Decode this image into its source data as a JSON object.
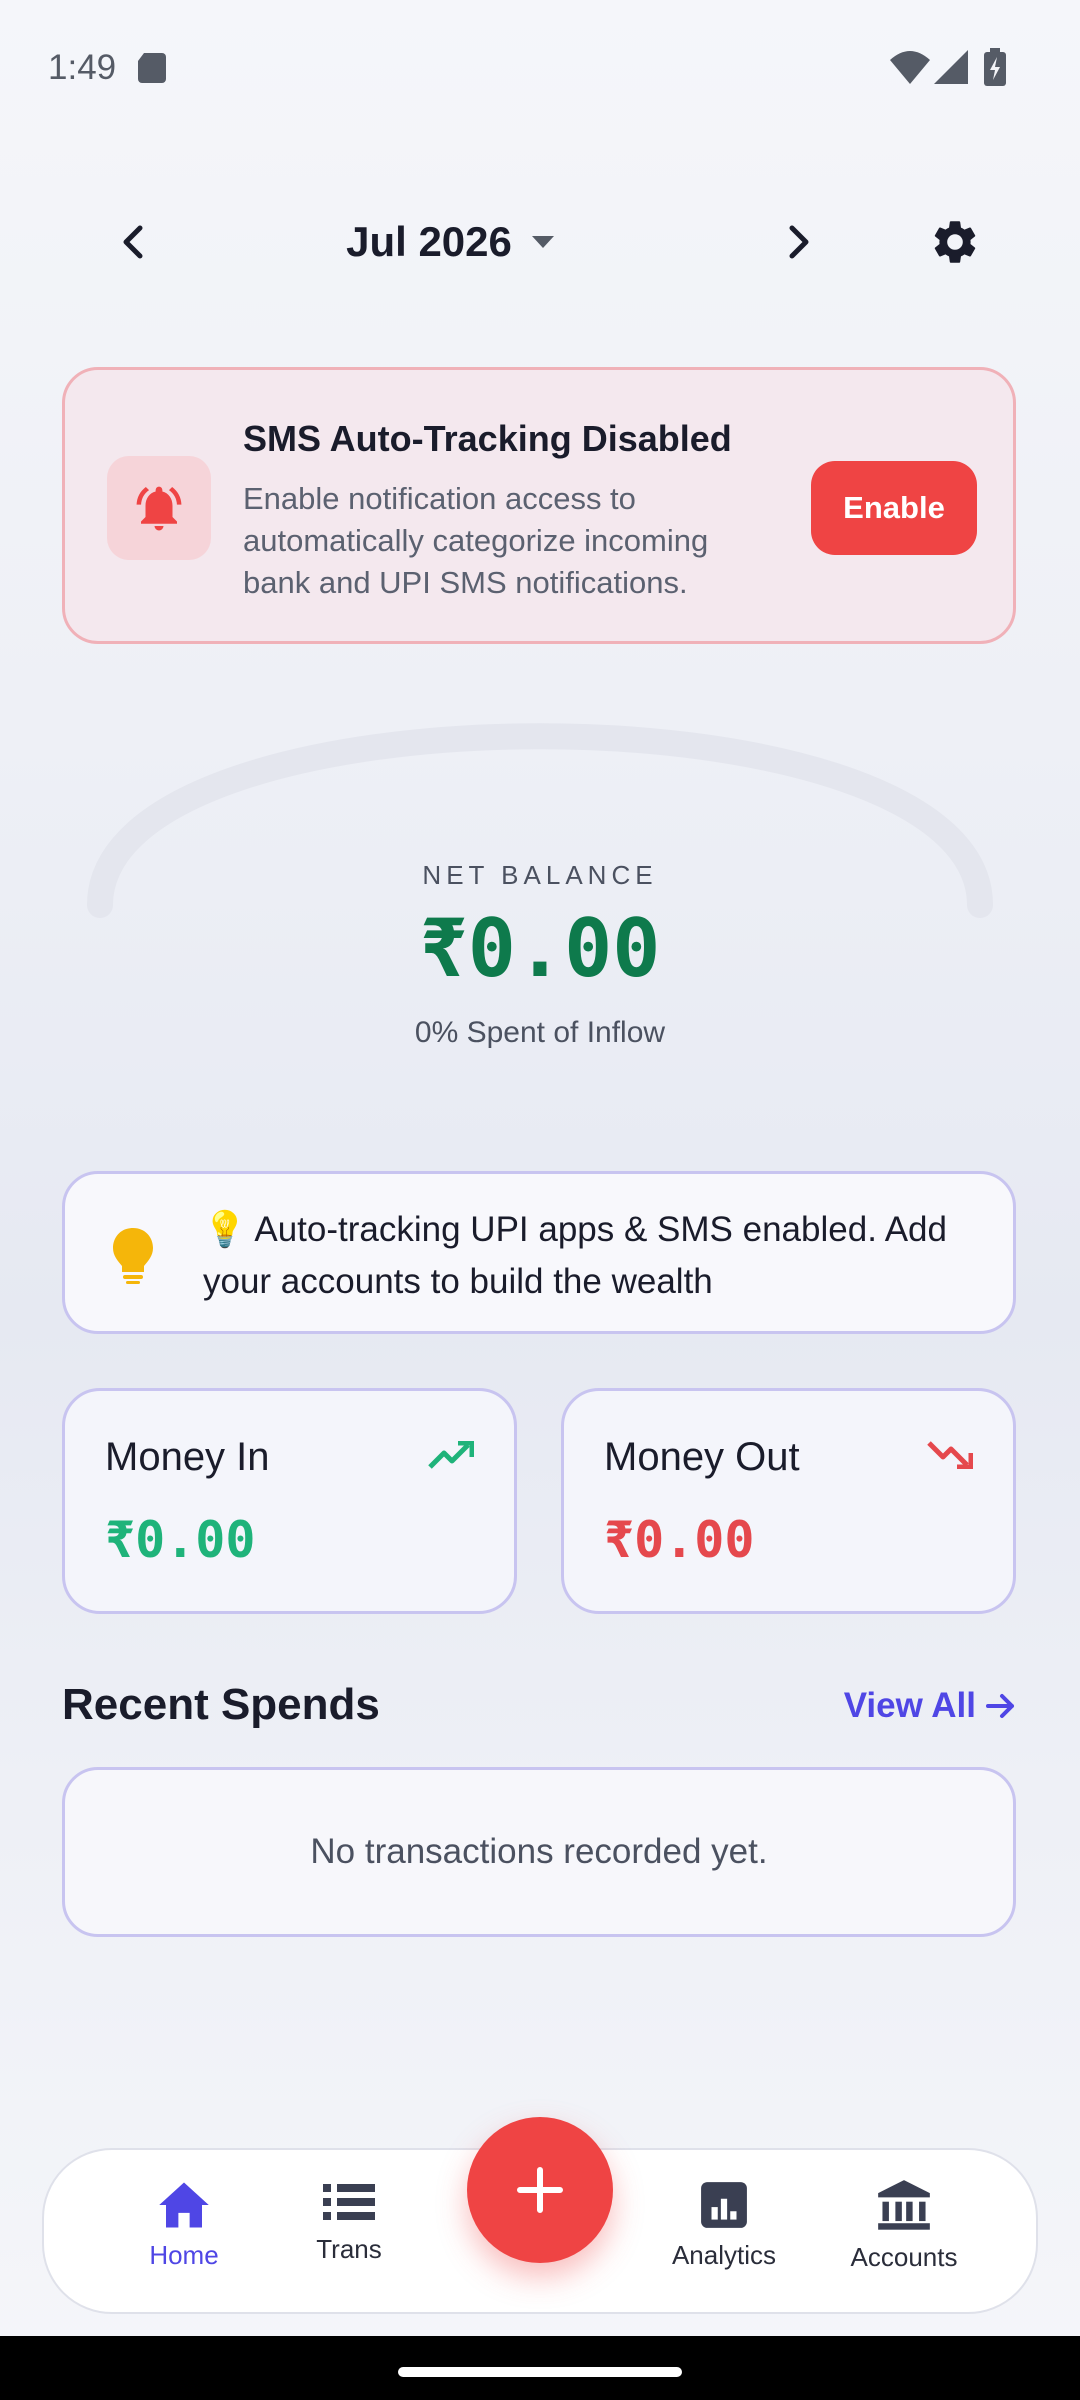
{
  "status_bar": {
    "time": "1:49"
  },
  "header": {
    "month": "Jul 2026"
  },
  "sms_banner": {
    "title": "SMS Auto-Tracking Disabled",
    "description": "Enable notification access to automatically categorize incoming bank and UPI SMS notifications.",
    "button_label": "Enable"
  },
  "balance": {
    "label": "NET BALANCE",
    "value": "₹0.00",
    "subtext": "0% Spent of Inflow",
    "spent_fraction": 0
  },
  "tip": {
    "text": "💡 Auto-tracking UPI apps & SMS enabled. Add your accounts to build the wealth"
  },
  "money_in": {
    "title": "Money In",
    "value": "₹0.00"
  },
  "money_out": {
    "title": "Money Out",
    "value": "₹0.00"
  },
  "recent": {
    "title": "Recent Spends",
    "view_all": "View All",
    "empty_text": "No transactions recorded yet."
  },
  "bottom_nav": {
    "items": [
      {
        "label": "Home",
        "icon": "home-icon",
        "active": true
      },
      {
        "label": "Trans",
        "icon": "list-icon",
        "active": false
      },
      {
        "label": "Analytics",
        "icon": "analytics-icon",
        "active": false
      },
      {
        "label": "Accounts",
        "icon": "bank-icon",
        "active": false
      }
    ],
    "fab_icon": "plus-icon"
  },
  "colors": {
    "primary": "#4f46e5",
    "danger": "#ef4444",
    "income": "#1fb37a",
    "balance": "#0e7a4c"
  }
}
